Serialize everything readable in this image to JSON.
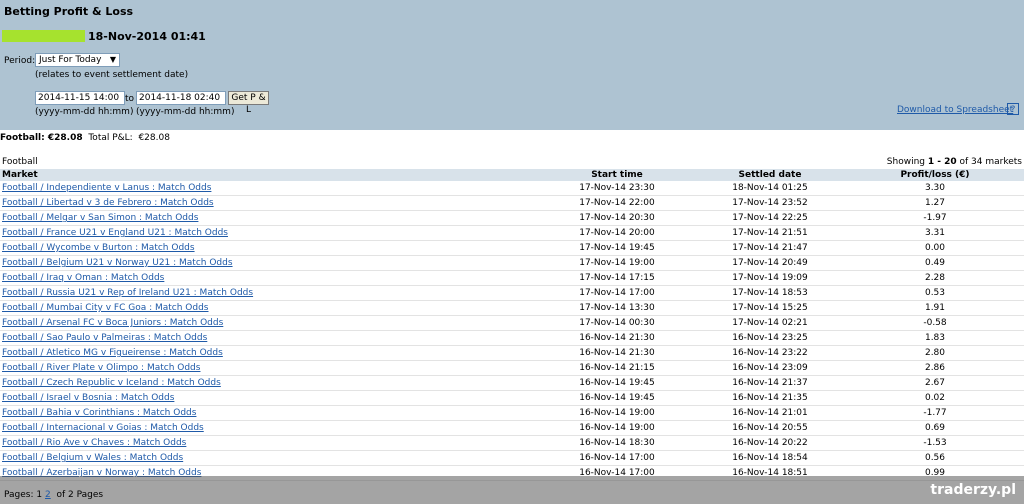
{
  "header": {
    "title": "Betting Profit & Loss",
    "datetime": "18-Nov-2014 01:41",
    "period_label": "Period:",
    "period_value": "Just For Today",
    "period_note": "(relates to event settlement date)",
    "from_value": "2014-11-15 14:00",
    "to_label": "to",
    "to_value": "2014-11-18 02:40",
    "getpl_label": "Get P & L",
    "hint": "(yyyy-mm-dd hh:mm)",
    "download_label": "Download to Spreadsheet",
    "help_label": "?"
  },
  "summary": {
    "sport_total_label": "Football: €28.08",
    "total_label": "Total P&L:",
    "total_value": "€28.08"
  },
  "section": {
    "label": "Football",
    "showing_prefix": "Showing ",
    "showing_range": "1 - 20",
    "showing_suffix": " of 34 markets"
  },
  "table": {
    "headers": [
      "Market",
      "Start time",
      "Settled date",
      "Profit/loss (€)"
    ],
    "rows": [
      {
        "market": "Football / Independiente v Lanus : Match Odds",
        "start": "17-Nov-14 23:30",
        "settled": "18-Nov-14 01:25",
        "pl": "3.30"
      },
      {
        "market": "Football / Libertad v 3 de Febrero : Match Odds",
        "start": "17-Nov-14 22:00",
        "settled": "17-Nov-14 23:52",
        "pl": "1.27"
      },
      {
        "market": "Football / Melgar v San Simon : Match Odds",
        "start": "17-Nov-14 20:30",
        "settled": "17-Nov-14 22:25",
        "pl": "-1.97"
      },
      {
        "market": "Football / France U21 v England U21 : Match Odds",
        "start": "17-Nov-14 20:00",
        "settled": "17-Nov-14 21:51",
        "pl": "3.31"
      },
      {
        "market": "Football / Wycombe v Burton : Match Odds",
        "start": "17-Nov-14 19:45",
        "settled": "17-Nov-14 21:47",
        "pl": "0.00"
      },
      {
        "market": "Football / Belgium U21 v Norway U21 : Match Odds",
        "start": "17-Nov-14 19:00",
        "settled": "17-Nov-14 20:49",
        "pl": "0.49"
      },
      {
        "market": "Football / Iraq v Oman : Match Odds",
        "start": "17-Nov-14 17:15",
        "settled": "17-Nov-14 19:09",
        "pl": "2.28"
      },
      {
        "market": "Football / Russia U21 v Rep of Ireland U21 : Match Odds",
        "start": "17-Nov-14 17:00",
        "settled": "17-Nov-14 18:53",
        "pl": "0.53"
      },
      {
        "market": "Football / Mumbai City v FC Goa : Match Odds",
        "start": "17-Nov-14 13:30",
        "settled": "17-Nov-14 15:25",
        "pl": "1.91"
      },
      {
        "market": "Football / Arsenal FC v Boca Juniors : Match Odds",
        "start": "17-Nov-14 00:30",
        "settled": "17-Nov-14 02:21",
        "pl": "-0.58"
      },
      {
        "market": "Football / Sao Paulo v Palmeiras : Match Odds",
        "start": "16-Nov-14 21:30",
        "settled": "16-Nov-14 23:25",
        "pl": "1.83"
      },
      {
        "market": "Football / Atletico MG v Figueirense : Match Odds",
        "start": "16-Nov-14 21:30",
        "settled": "16-Nov-14 23:22",
        "pl": "2.80"
      },
      {
        "market": "Football / River Plate v Olimpo : Match Odds",
        "start": "16-Nov-14 21:15",
        "settled": "16-Nov-14 23:09",
        "pl": "2.86"
      },
      {
        "market": "Football / Czech Republic v Iceland : Match Odds",
        "start": "16-Nov-14 19:45",
        "settled": "16-Nov-14 21:37",
        "pl": "2.67"
      },
      {
        "market": "Football / Israel v Bosnia : Match Odds",
        "start": "16-Nov-14 19:45",
        "settled": "16-Nov-14 21:35",
        "pl": "0.02"
      },
      {
        "market": "Football / Bahia v Corinthians : Match Odds",
        "start": "16-Nov-14 19:00",
        "settled": "16-Nov-14 21:01",
        "pl": "-1.77"
      },
      {
        "market": "Football / Internacional v Goias : Match Odds",
        "start": "16-Nov-14 19:00",
        "settled": "16-Nov-14 20:55",
        "pl": "0.69"
      },
      {
        "market": "Football / Rio Ave v Chaves : Match Odds",
        "start": "16-Nov-14 18:30",
        "settled": "16-Nov-14 20:22",
        "pl": "-1.53"
      },
      {
        "market": "Football / Belgium v Wales : Match Odds",
        "start": "16-Nov-14 17:00",
        "settled": "16-Nov-14 18:54",
        "pl": "0.56"
      },
      {
        "market": "Football / Azerbaijan v Norway : Match Odds",
        "start": "16-Nov-14 17:00",
        "settled": "16-Nov-14 18:51",
        "pl": "0.99"
      }
    ]
  },
  "pagination": {
    "label": "Pages:",
    "current": "1",
    "next": "2",
    "of_label": "of 2 Pages"
  },
  "watermark": "traderzy.pl",
  "colors": {
    "header_bg": "#aec3d2",
    "link": "#1f5aa8",
    "user_highlight": "#a6e22e"
  }
}
